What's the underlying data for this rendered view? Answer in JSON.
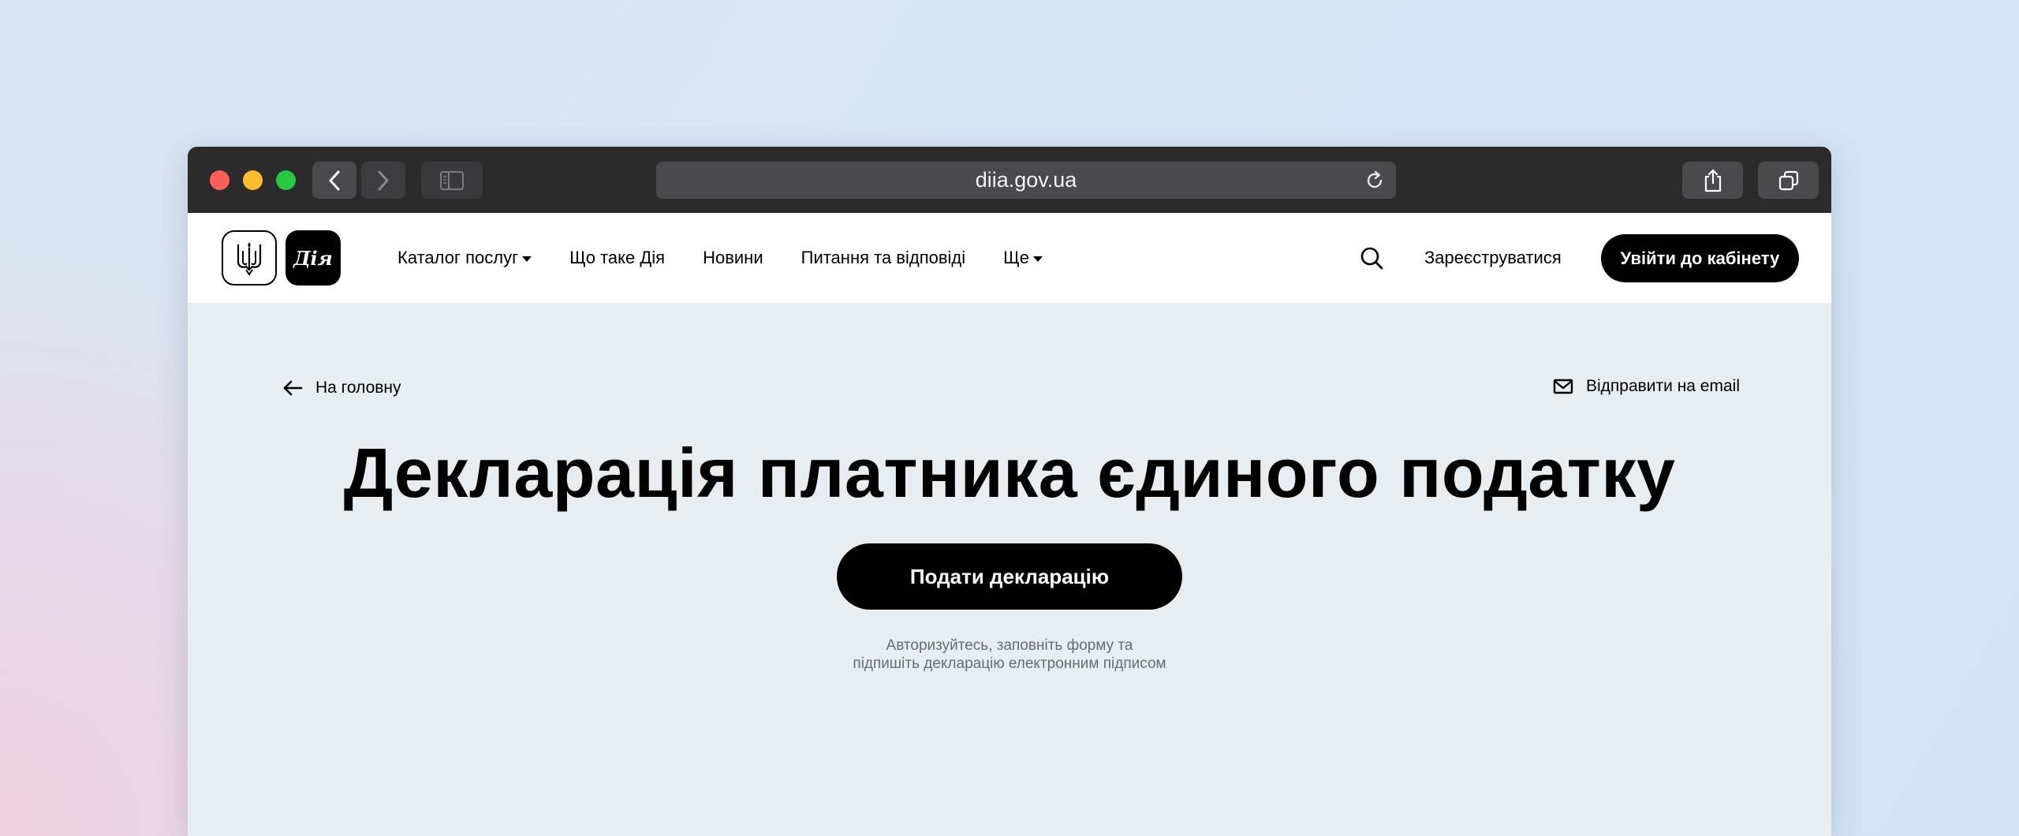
{
  "browser": {
    "url": "diia.gov.ua",
    "icons": {
      "back": "chevron-left-icon",
      "forward": "chevron-right-icon",
      "sidebar": "sidebar-icon",
      "reload": "reload-icon",
      "share": "share-icon",
      "tabs": "tabs-overview-icon"
    }
  },
  "header": {
    "logo_text": "Дія",
    "nav": [
      {
        "label": "Каталог послуг",
        "has_dropdown": true
      },
      {
        "label": "Що таке Дія",
        "has_dropdown": false
      },
      {
        "label": "Новини",
        "has_dropdown": false
      },
      {
        "label": "Питання та відповіді",
        "has_dropdown": false
      },
      {
        "label": "Ще",
        "has_dropdown": true
      }
    ],
    "register_label": "Зареєструватися",
    "login_label": "Увійти до кабінету"
  },
  "main": {
    "back_label": "На головну",
    "email_label": "Відправити на email",
    "title": "Декларація платника єдиного податку",
    "cta_label": "Подати декларацію",
    "hint": "Авторизуйтесь, заповніть форму та підпишіть декларацію електронним підписом"
  },
  "colors": {
    "chrome_bg": "#2b2b2c",
    "page_bg": "#e8edf1",
    "accent": "#000000"
  }
}
